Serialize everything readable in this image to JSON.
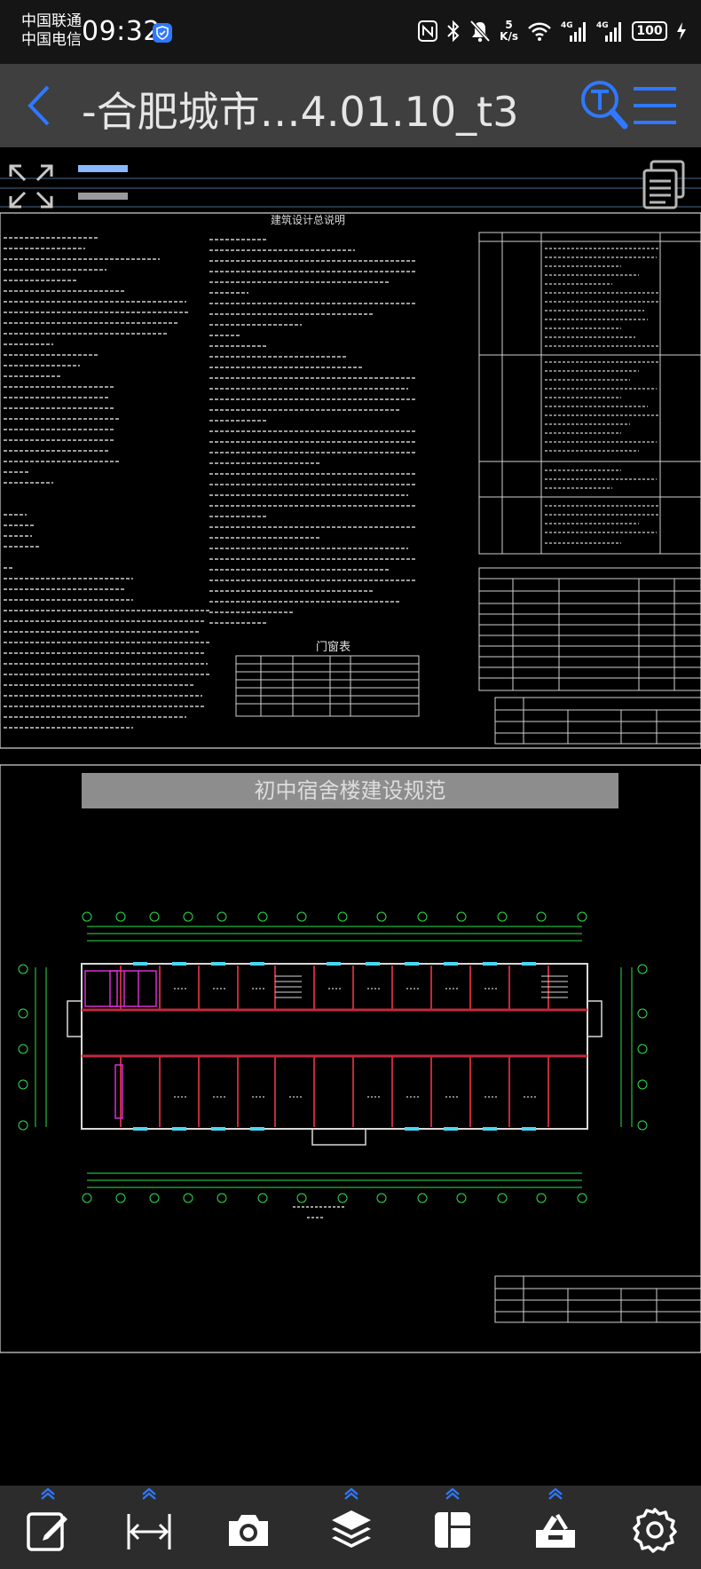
{
  "status_bar": {
    "carrier_1": "中国联通",
    "carrier_2": "中国电信",
    "time": "09:32",
    "net_speed_value": "5",
    "net_speed_unit": "K/s",
    "signal_label_1": "4G",
    "signal_label_2": "4G",
    "battery": "100",
    "icons": [
      "shield-icon",
      "nfc-icon",
      "bluetooth-icon",
      "bell-muted-icon",
      "wifi-icon",
      "signal-icon",
      "charging-icon"
    ]
  },
  "header": {
    "title": "-合肥城市…4.01.10_t3",
    "icons": [
      "back-icon",
      "text-search-icon",
      "menu-icon"
    ]
  },
  "viewer": {
    "caption": "初中宿舍楼建设规范",
    "drawing_title": "建筑设计总说明",
    "door_window_table_title": "门窗表",
    "icons": [
      "fit-screen-icon",
      "layer-lines-icon",
      "document-list-icon"
    ]
  },
  "colors": {
    "status_bg": "#151515",
    "header_bg": "#3f3f3f",
    "accent": "#2f78ff",
    "toolbar_bg": "#2c2c2c",
    "cad_line": "#d9d9d9",
    "cad_green": "#2ee04a",
    "cad_red": "#c02a3a",
    "cad_magenta": "#d42fd0",
    "cad_cyan": "#49d7f2"
  },
  "toolbar": {
    "tools": [
      {
        "icon": "edit-icon"
      },
      {
        "icon": "measure-icon"
      },
      {
        "icon": "camera-icon"
      },
      {
        "icon": "layers-icon"
      },
      {
        "icon": "layout-icon"
      },
      {
        "icon": "toolbox-icon"
      },
      {
        "icon": "settings-icon"
      }
    ]
  }
}
